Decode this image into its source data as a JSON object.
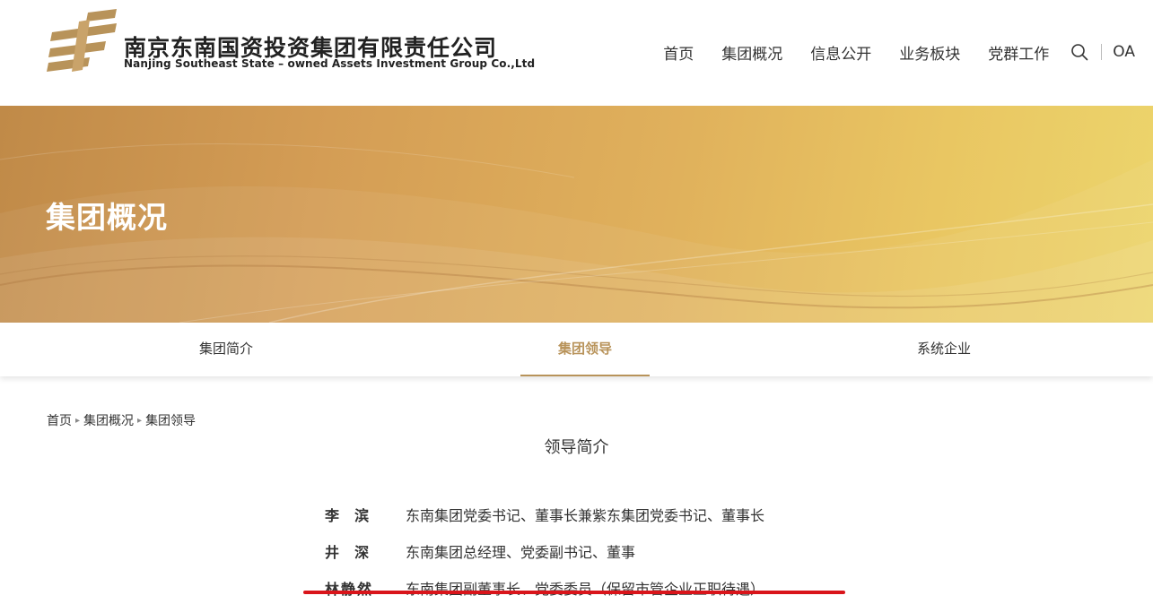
{
  "header": {
    "brand_cn": "南京东南国资投资集团有限责任公司",
    "brand_en": "Nanjing Southeast State – owned Assets Investment Group Co.,Ltd",
    "nav": [
      "首页",
      "集团概况",
      "信息公开",
      "业务板块",
      "党群工作"
    ],
    "oa_label": "OA"
  },
  "banner": {
    "title": "集团概况"
  },
  "subnav": {
    "items": [
      "集团简介",
      "集团领导",
      "系统企业"
    ],
    "active": "集团领导"
  },
  "breadcrumb": [
    "首页",
    "集团概况",
    "集团领导"
  ],
  "content": {
    "section_title": "领导简介",
    "leaders": [
      {
        "name": "李  滨",
        "title": "东南集团党委书记、董事长兼紫东集团党委书记、董事长"
      },
      {
        "name": "井  深",
        "title": "东南集团总经理、党委副书记、董事"
      },
      {
        "name": "林静然",
        "title": "东南集团副董事长、党委委员（保留市管企业正职待遇）"
      }
    ]
  },
  "colors": {
    "brand_gold": "#b8935a",
    "banner_start": "#c08a48",
    "banner_end": "#ecd56c",
    "annotation_red": "#d9151b"
  },
  "icons": {
    "search": "search-icon",
    "logo": "logo-icon"
  }
}
